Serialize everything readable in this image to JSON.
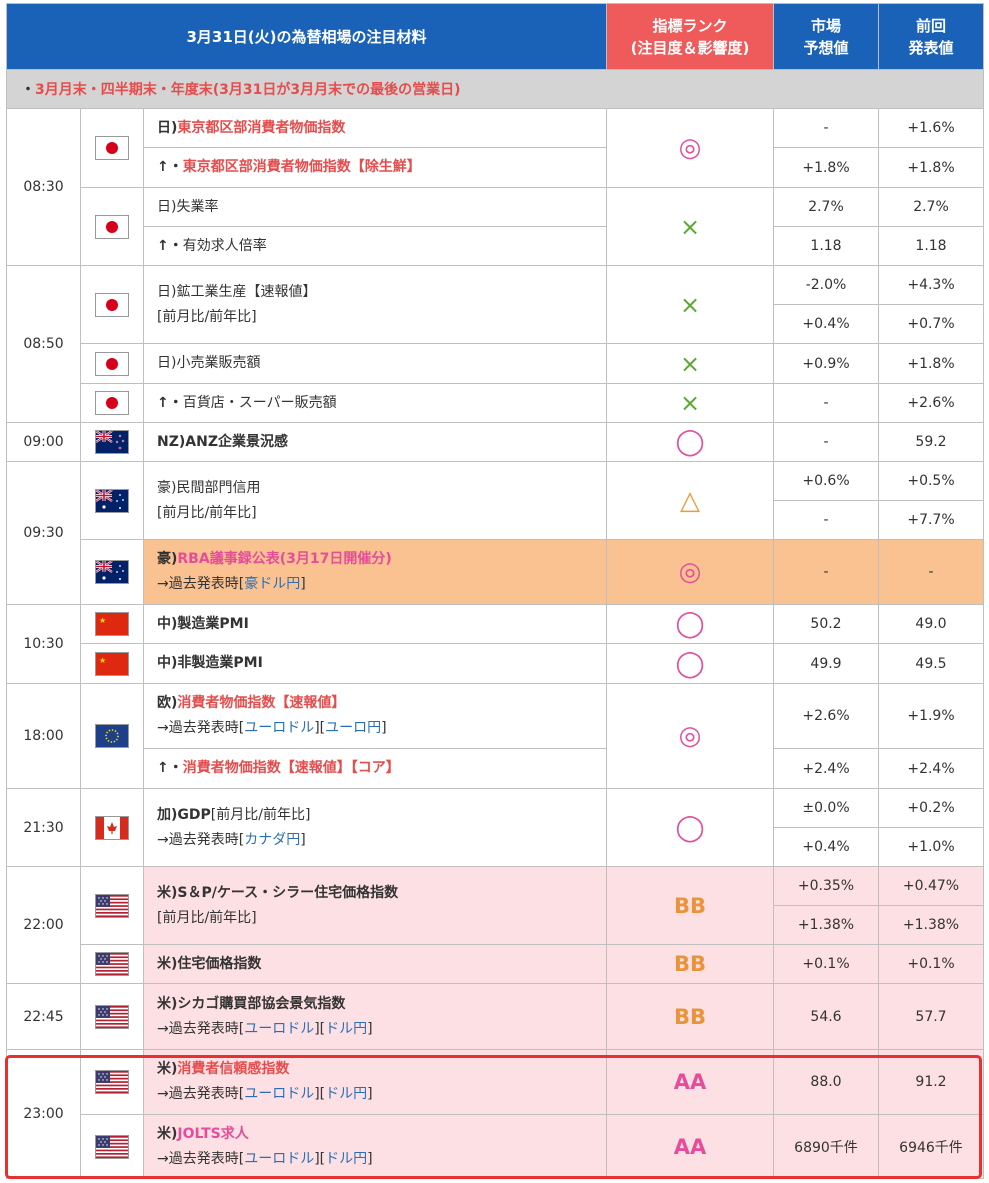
{
  "header": {
    "title": "3月31日(火)の為替相場の注目材料",
    "rank_line1": "指標ランク",
    "rank_line2": "(注目度＆影響度)",
    "forecast_line1": "市場",
    "forecast_line2": "予想値",
    "previous_line1": "前回",
    "previous_line2": "発表値"
  },
  "note": {
    "bullet": "・",
    "text": "3月月末・四半期末・年度末(3月31日が3月月末での最後の営業日)"
  },
  "colors": {
    "header_blue": "#1a62b7",
    "header_red": "#ef5a5a",
    "pink_row": "#fde0e3",
    "orange_row": "#fac291",
    "highlight": "#e8302f"
  },
  "flags": {
    "jp": "japan-flag-icon",
    "nz": "new-zealand-flag-icon",
    "au": "australia-flag-icon",
    "cn": "china-flag-icon",
    "eu": "eu-flag-icon",
    "ca": "canada-flag-icon",
    "us": "us-flag-icon"
  },
  "times": {
    "t0830": "08:30",
    "t0850": "08:50",
    "t0900": "09:00",
    "t0930": "09:30",
    "t1030": "10:30",
    "t1800": "18:00",
    "t2130": "21:30",
    "t2200": "22:00",
    "t2245": "22:45",
    "t2300": "23:00"
  },
  "symbols": {
    "double_circle": "◎",
    "circle": "◯",
    "cross": "×",
    "triangle": "△",
    "bb": "BB",
    "aa": "AA"
  },
  "link_prefix": "→過去発表時",
  "links": {
    "audjpy": "豪ドル円",
    "eurusd": "ユーロドル",
    "eurjpy": "ユーロ円",
    "cadjpy": "カナダ円",
    "usdjpy": "ドル円"
  },
  "sub_note": "[前月比/前年比]",
  "rows": {
    "tokyo_cpi": {
      "country": "日)",
      "name": "東京都区部消費者物価指数",
      "forecast": "-",
      "previous": "+1.6%"
    },
    "tokyo_core": {
      "prefix": "↑・",
      "name": "東京都区部消費者物価指数【除生鮮】",
      "forecast": "+1.8%",
      "previous": "+1.8%"
    },
    "unemployment": {
      "country": "日)",
      "name": "失業率",
      "forecast": "2.7%",
      "previous": "2.7%"
    },
    "jobs_ratio": {
      "prefix": "↑・",
      "name": "有効求人倍率",
      "forecast": "1.18",
      "previous": "1.18"
    },
    "industrial": {
      "country": "日)",
      "name": "鉱工業生産【速報値】",
      "forecast_mom": "-2.0%",
      "previous_mom": "+4.3%",
      "forecast_yoy": "+0.4%",
      "previous_yoy": "+0.7%"
    },
    "retail": {
      "country": "日)",
      "name": "小売業販売額",
      "forecast": "+0.9%",
      "previous": "+1.8%"
    },
    "dept_store": {
      "prefix": "↑・",
      "name": "百貨店・スーパー販売額",
      "forecast": "-",
      "previous": "+2.6%"
    },
    "anz": {
      "country": "NZ)",
      "name": "ANZ企業景況感",
      "forecast": "-",
      "previous": "59.2"
    },
    "private_credit": {
      "country": "豪)",
      "name": "民間部門信用",
      "forecast_mom": "+0.6%",
      "previous_mom": "+0.5%",
      "forecast_yoy": "-",
      "previous_yoy": "+7.7%"
    },
    "rba": {
      "country": "豪)",
      "name": "RBA議事録公表(3月17日開催分)",
      "forecast": "-",
      "previous": "-"
    },
    "cn_mfg": {
      "country": "中)",
      "name": "製造業PMI",
      "forecast": "50.2",
      "previous": "49.0"
    },
    "cn_nonmfg": {
      "country": "中)",
      "name": "非製造業PMI",
      "forecast": "49.9",
      "previous": "49.5"
    },
    "eu_cpi": {
      "country": "欧)",
      "name": "消費者物価指数【速報値】",
      "forecast": "+2.6%",
      "previous": "+1.9%"
    },
    "eu_core": {
      "prefix": "↑・",
      "name": "消費者物価指数【速報値】【コア】",
      "forecast": "+2.4%",
      "previous": "+2.4%"
    },
    "ca_gdp": {
      "country": "加)GDP",
      "name": "[前月比/前年比]",
      "forecast_mom": "±0.0%",
      "previous_mom": "+0.2%",
      "forecast_yoy": "+0.4%",
      "previous_yoy": "+1.0%"
    },
    "cs_hpi": {
      "country": "米)",
      "name": "S＆P/ケース・シラー住宅価格指数",
      "forecast_mom": "+0.35%",
      "previous_mom": "+0.47%",
      "forecast_yoy": "+1.38%",
      "previous_yoy": "+1.38%"
    },
    "hpi": {
      "country": "米)",
      "name": "住宅価格指数",
      "forecast": "+0.1%",
      "previous": "+0.1%"
    },
    "chicago": {
      "country": "米)",
      "name": "シカゴ購買部協会景気指数",
      "forecast": "54.6",
      "previous": "57.7"
    },
    "confidence": {
      "country": "米)",
      "name": "消費者信頼感指数",
      "forecast": "88.0",
      "previous": "91.2"
    },
    "jolts": {
      "country": "米)",
      "name": "JOLTS求人",
      "forecast": "6890千件",
      "previous": "6946千件"
    }
  }
}
